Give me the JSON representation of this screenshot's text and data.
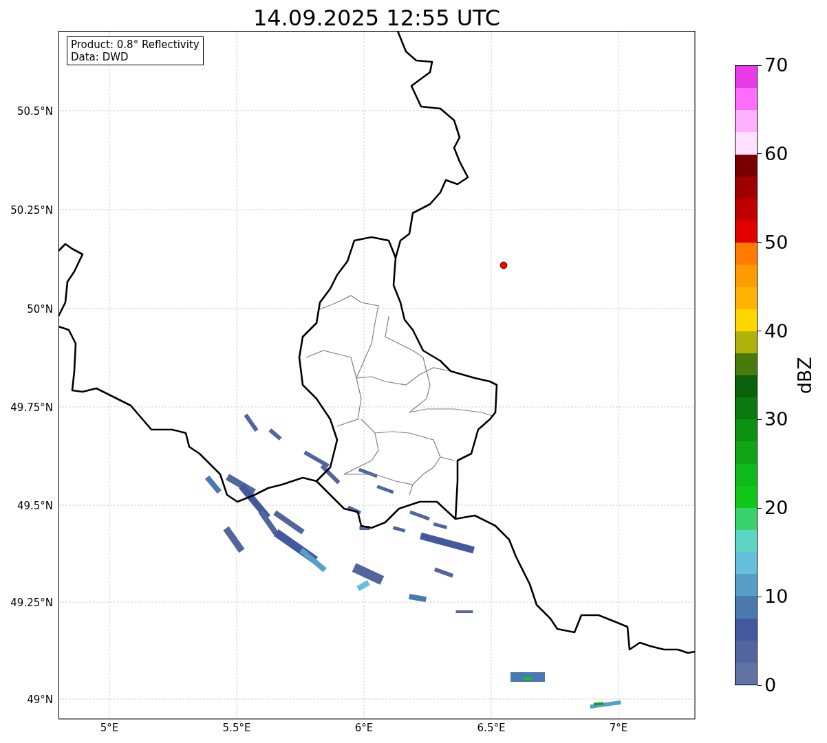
{
  "title": "14.09.2025 12:55 UTC",
  "info_box": {
    "lines": [
      "Product: 0.8° Reflectivity",
      "Data: DWD"
    ]
  },
  "map": {
    "x_ticks": [
      "5°E",
      "5.5°E",
      "6°E",
      "6.5°E",
      "7°E"
    ],
    "y_ticks": [
      "50.5°N",
      "50.25°N",
      "50°N",
      "49.75°N",
      "49.5°N",
      "49.25°N",
      "49°N"
    ]
  },
  "colorbar": {
    "label": "dBZ",
    "ticks": [
      "70",
      "60",
      "50",
      "40",
      "30",
      "20",
      "10",
      "0"
    ],
    "segments": [
      {
        "color": "#e83ae8"
      },
      {
        "color": "#ff6cff"
      },
      {
        "color": "#ffb0ff"
      },
      {
        "color": "#ffe0ff"
      },
      {
        "color": "#780000"
      },
      {
        "color": "#a00000"
      },
      {
        "color": "#c00000"
      },
      {
        "color": "#e50000"
      },
      {
        "color": "#ff7a00"
      },
      {
        "color": "#ff9b00"
      },
      {
        "color": "#ffb300"
      },
      {
        "color": "#ffd700"
      },
      {
        "color": "#b0b20a"
      },
      {
        "color": "#487a0c"
      },
      {
        "color": "#0a620c"
      },
      {
        "color": "#0a7a0f"
      },
      {
        "color": "#0d9112"
      },
      {
        "color": "#0fa515"
      },
      {
        "color": "#10b91a"
      },
      {
        "color": "#10c81a"
      },
      {
        "color": "#3ad26f"
      },
      {
        "color": "#5cd6c3"
      },
      {
        "color": "#64c0dc"
      },
      {
        "color": "#579fc8"
      },
      {
        "color": "#4a78b0"
      },
      {
        "color": "#42599f"
      },
      {
        "color": "#52659e"
      },
      {
        "color": "#6272a4"
      }
    ]
  }
}
